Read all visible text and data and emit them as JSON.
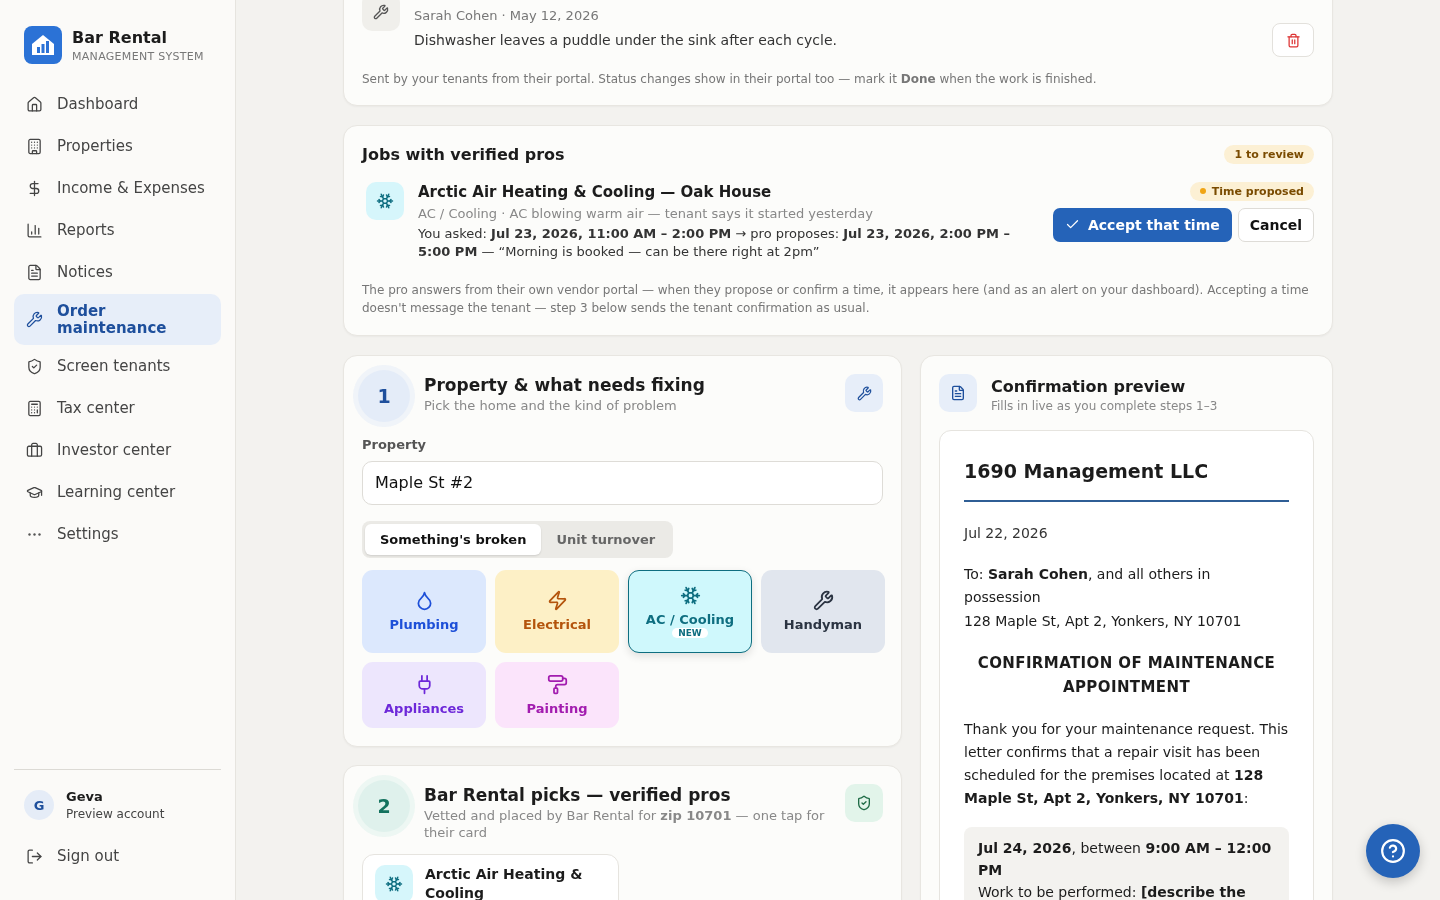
{
  "sidebar": {
    "brand": "Bar Rental",
    "tagline": "MANAGEMENT SYSTEM",
    "items": [
      {
        "label": "Dashboard",
        "kind": "home",
        "selected": false
      },
      {
        "label": "Properties",
        "kind": "building",
        "selected": false
      },
      {
        "label": "Income & Expenses",
        "kind": "dollar",
        "selected": false
      },
      {
        "label": "Reports",
        "kind": "chart",
        "selected": false
      },
      {
        "label": "Notices",
        "kind": "file",
        "selected": false
      },
      {
        "label": "Order maintenance",
        "kind": "wrench",
        "selected": true
      },
      {
        "label": "Screen tenants",
        "kind": "shield",
        "selected": false
      },
      {
        "label": "Tax center",
        "kind": "calculator",
        "selected": false
      },
      {
        "label": "Investor center",
        "kind": "briefcase",
        "selected": false
      },
      {
        "label": "Learning center",
        "kind": "cap",
        "selected": false
      },
      {
        "label": "Settings",
        "kind": "dots",
        "selected": false
      }
    ],
    "user": {
      "initial": "G",
      "name": "Geva",
      "role": "Preview account"
    },
    "sign_out": "Sign out"
  },
  "request_card": {
    "meta": "Sarah Cohen · May 12, 2026",
    "description": "Dishwasher leaves a puddle under the sink after each cycle.",
    "note": "Sent by your tenants from their portal. Status changes show in their portal too — mark it **Done** when the work is finished."
  },
  "jobs": {
    "title": "Jobs with verified pros",
    "badge": "1 to review",
    "job": {
      "name": "Arctic Air Heating & Cooling — Oak House",
      "sub": "AC / Cooling · AC blowing warm air — tenant says it started yesterday",
      "detail": "You asked: **Jul 23, 2026, 11:00 AM – 2:00 PM** → pro proposes: **Jul 23, 2026, 2:00 PM – 5:00 PM** — “Morning is booked — can be there right at 2pm”",
      "status": "Time proposed",
      "accept": "Accept that time",
      "cancel": "Cancel"
    },
    "note": "The pro answers from their own vendor portal — when they propose or confirm a time, it appears here (and as an alert on your dashboard). Accepting a time doesn't message the tenant — step 3 below sends the tenant confirmation as usual."
  },
  "step1": {
    "number": "1",
    "title": "Property & what needs fixing",
    "subtitle": "Pick the home and the kind of problem",
    "property_label": "Property",
    "property_value": "Maple St #2",
    "modes": [
      {
        "label": "Something's broken",
        "selected": true
      },
      {
        "label": "Unit turnover",
        "selected": false
      }
    ],
    "categories": [
      {
        "label": "Plumbing",
        "kind": "plumbing",
        "selected": false
      },
      {
        "label": "Electrical",
        "kind": "electrical",
        "selected": false
      },
      {
        "label": "AC / Cooling",
        "kind": "cooling",
        "selected": true,
        "badge": "NEW"
      },
      {
        "label": "Handyman",
        "kind": "handyman",
        "selected": false
      },
      {
        "label": "Appliances",
        "kind": "appliances",
        "selected": false
      },
      {
        "label": "Painting",
        "kind": "painting",
        "selected": false
      }
    ]
  },
  "step2": {
    "number": "2",
    "title": "Bar Rental picks — verified pros",
    "subtitle": "Vetted and placed by Bar Rental for **zip 10701** — one tap for their card",
    "pro": "Arctic Air Heating & Cooling"
  },
  "preview": {
    "title": "Confirmation preview",
    "subtitle": "Fills in live as you complete steps 1–3",
    "letter": {
      "company": "1690 Management LLC",
      "date": "Jul 22, 2026",
      "to": "To: **Sarah Cohen**, and all others in possession",
      "address": "128 Maple St, Apt 2, Yonkers, NY 10701",
      "heading": "CONFIRMATION OF MAINTENANCE APPOINTMENT",
      "body": "Thank you for your maintenance request. This letter confirms that a repair visit has been scheduled for the premises located at **128 Maple St, Apt 2, Yonkers, NY 10701**:",
      "when": "**Jul 24, 2026**, between **9:00 AM – 12:00 PM**",
      "work": "Work to be performed: **[describe the**"
    }
  }
}
